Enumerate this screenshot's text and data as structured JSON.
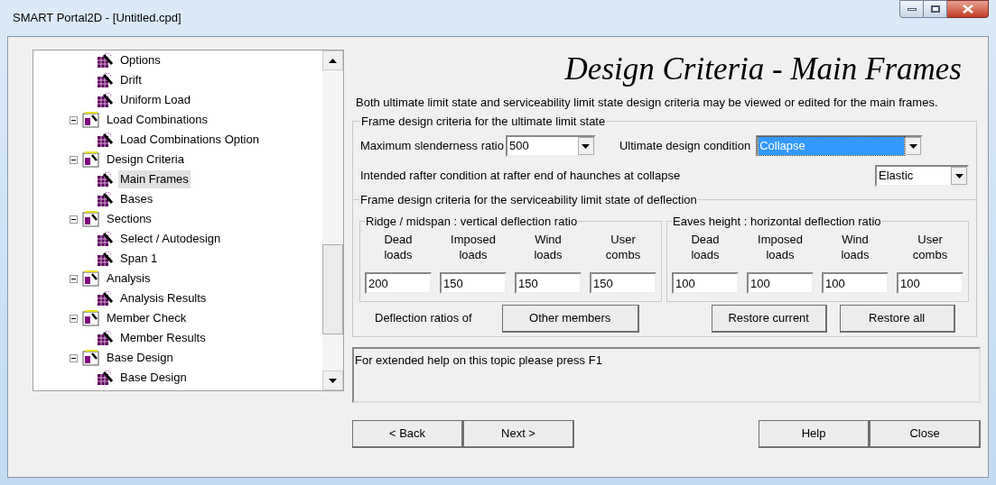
{
  "window": {
    "title": "SMART Portal2D - [Untitled.cpd]"
  },
  "tree": {
    "items": [
      {
        "children": [
          {
            "label": "Options",
            "selected": false
          },
          {
            "label": "Drift",
            "selected": false
          },
          {
            "label": "Uniform Load",
            "selected": false
          }
        ]
      },
      {
        "label": "Load Combinations",
        "selected": false,
        "expanded": true,
        "children": [
          {
            "label": "Load Combinations Option",
            "selected": false
          }
        ]
      },
      {
        "label": "Design Criteria",
        "selected": false,
        "expanded": true,
        "children": [
          {
            "label": "Main Frames",
            "selected": true
          },
          {
            "label": "Bases",
            "selected": false
          }
        ]
      },
      {
        "label": "Sections",
        "selected": false,
        "expanded": true,
        "children": [
          {
            "label": "Select / Autodesign",
            "selected": false
          },
          {
            "label": "Span 1",
            "selected": false
          }
        ]
      },
      {
        "label": "Analysis",
        "selected": false,
        "expanded": true,
        "children": [
          {
            "label": "Analysis Results",
            "selected": false
          }
        ]
      },
      {
        "label": "Member Check",
        "selected": false,
        "expanded": true,
        "children": [
          {
            "label": "Member Results",
            "selected": false
          }
        ]
      },
      {
        "label": "Base Design",
        "selected": false,
        "expanded": true,
        "children": [
          {
            "label": "Base Design",
            "selected": false
          }
        ]
      }
    ]
  },
  "page": {
    "heading": "Design Criteria - Main Frames",
    "description": "Both ultimate limit state and serviceability limit state design criteria may be viewed or edited for the main frames.",
    "ultimate": {
      "legend": "Frame design criteria for the ultimate limit state",
      "slenderness": {
        "label": "Maximum slenderness ratio",
        "value": "500",
        "focused": false
      },
      "condition": {
        "label": "Ultimate design condition",
        "value": "Collapse",
        "focused": true
      },
      "rafter": {
        "label": "Intended rafter condition at rafter end of haunches at collapse",
        "value": "Elastic",
        "focused": false
      }
    },
    "serviceability": {
      "legend": "Frame design criteria for the serviceability limit state of deflection",
      "groups": [
        {
          "legend": "Ridge / midspan : vertical deflection ratio",
          "columns": [
            {
              "header": "Dead\nloads",
              "value": "200"
            },
            {
              "header": "Imposed\nloads",
              "value": "150"
            },
            {
              "header": "Wind\nloads",
              "value": "150"
            },
            {
              "header": "User\ncombs",
              "value": "150"
            }
          ]
        },
        {
          "legend": "Eaves height : horizontal deflection ratio",
          "columns": [
            {
              "header": "Dead\nloads",
              "value": "100"
            },
            {
              "header": "Imposed\nloads",
              "value": "100"
            },
            {
              "header": "Wind\nloads",
              "value": "100"
            },
            {
              "header": "User\ncombs",
              "value": "100"
            }
          ]
        }
      ],
      "ratios_label": "Deflection ratios of",
      "buttons": [
        "Other members",
        "Restore current",
        "Restore all"
      ]
    },
    "help_text": "For extended help on this topic please press F1"
  },
  "footer": {
    "left_buttons": [
      "< Back",
      "Next >"
    ],
    "right_buttons": [
      "Help",
      "Close"
    ]
  }
}
